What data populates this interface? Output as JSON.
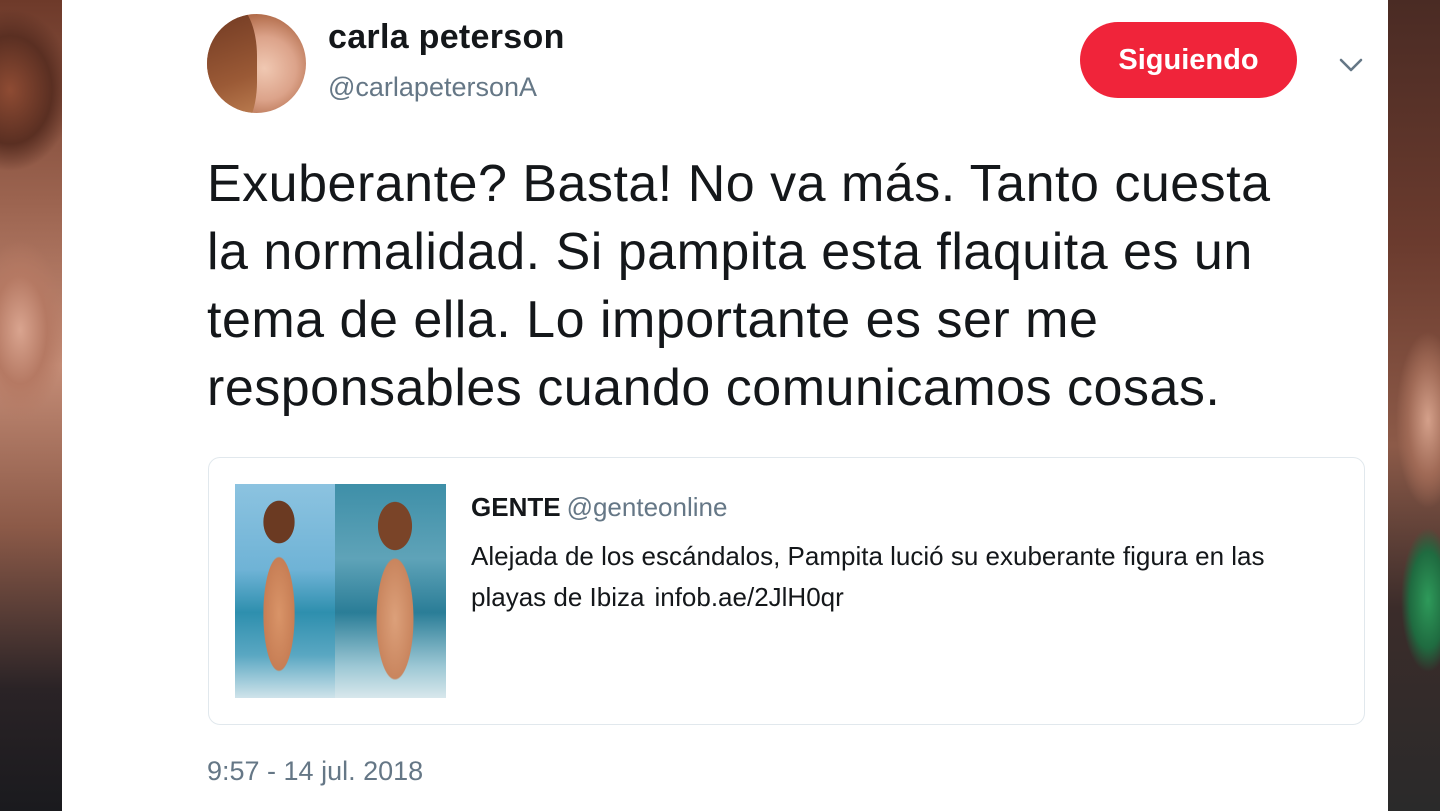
{
  "tweet": {
    "author": {
      "display_name": "carla peterson",
      "handle": "@carlapetersonA"
    },
    "follow_button_label": "Siguiendo",
    "menu_icon": "chevron-down-icon",
    "text_lines": [
      "Exuberante? Basta! No va más. Tanto cuesta",
      "la normalidad. Si pampita esta flaquita es un",
      "tema de ella. Lo importante es ser me",
      "responsables cuando comunicamos cosas."
    ],
    "quoted": {
      "name": "GENTE",
      "handle": "@genteonline",
      "body_line1": "Alejada de los escándalos, Pampita lució su exuberante figura en las",
      "body_line2": "playas de Ibiza",
      "link": "infob.ae/2JlH0qr"
    },
    "timestamp": "9:57 - 14 jul. 2018"
  },
  "colors": {
    "follow_button": "#f0243a",
    "text": "#14171a",
    "secondary_text": "#657786",
    "border": "#e1e8ed"
  }
}
